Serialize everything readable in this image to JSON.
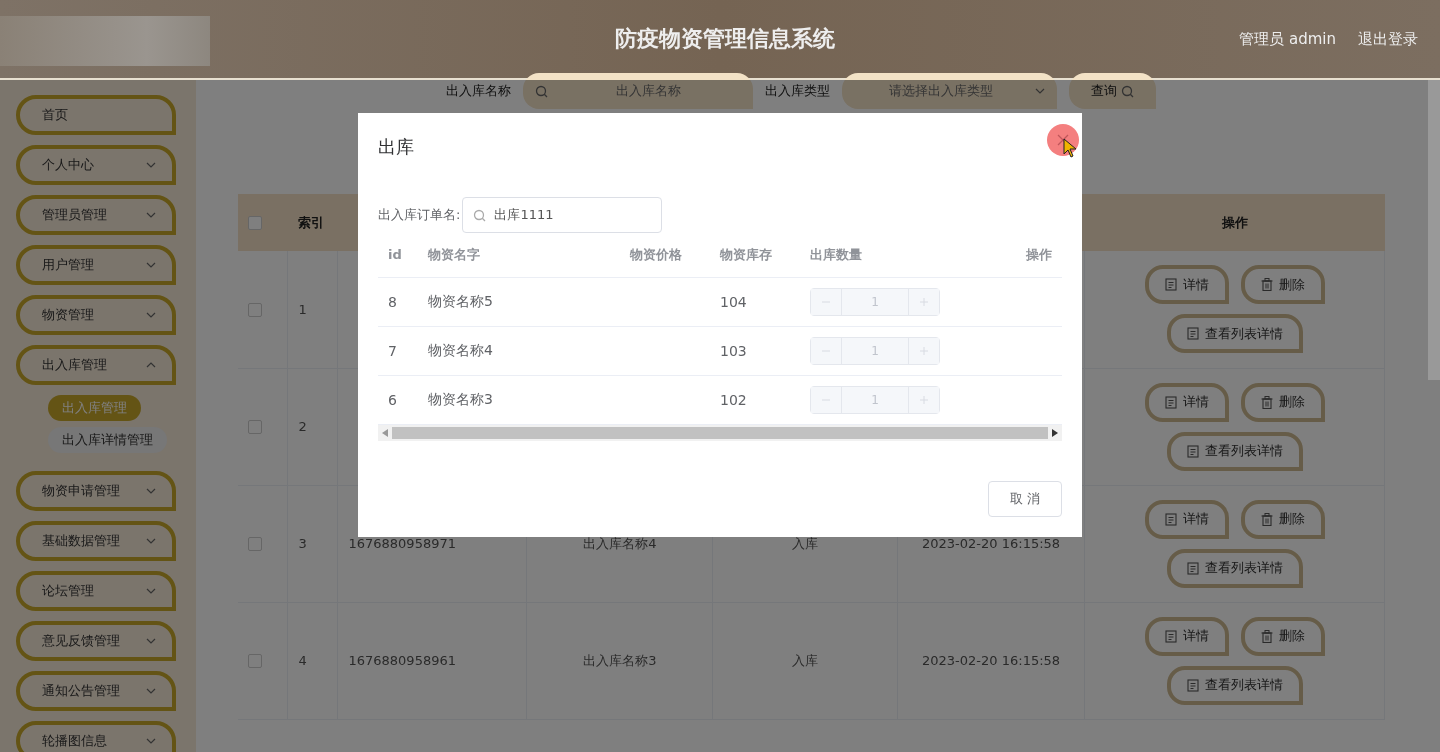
{
  "header": {
    "title": "防疫物资管理信息系统",
    "user": "管理员 admin",
    "logout": "退出登录"
  },
  "sidebar": {
    "items": [
      {
        "label": "首页",
        "kind": "link"
      },
      {
        "label": "个人中心",
        "kind": "menu",
        "expanded": false
      },
      {
        "label": "管理员管理",
        "kind": "menu",
        "expanded": false
      },
      {
        "label": "用户管理",
        "kind": "menu",
        "expanded": false
      },
      {
        "label": "物资管理",
        "kind": "menu",
        "expanded": false
      },
      {
        "label": "出入库管理",
        "kind": "menu",
        "expanded": true,
        "children": [
          {
            "label": "出入库管理",
            "selected": true
          },
          {
            "label": "出入库详情管理",
            "selected": false
          }
        ]
      },
      {
        "label": "物资申请管理",
        "kind": "menu",
        "expanded": false
      },
      {
        "label": "基础数据管理",
        "kind": "menu",
        "expanded": false
      },
      {
        "label": "论坛管理",
        "kind": "menu",
        "expanded": false
      },
      {
        "label": "意见反馈管理",
        "kind": "menu",
        "expanded": false
      },
      {
        "label": "通知公告管理",
        "kind": "menu",
        "expanded": false
      },
      {
        "label": "轮播图信息",
        "kind": "menu",
        "expanded": false
      }
    ]
  },
  "search": {
    "fields": [
      {
        "label": "出入库名称",
        "kind": "text",
        "placeholder": "出入库名称"
      },
      {
        "label": "出入库类型",
        "kind": "select",
        "placeholder": "请选择出入库类型"
      }
    ],
    "button": "查询"
  },
  "table": {
    "select_all": {
      "checked": false
    },
    "columns": {
      "index": "索引",
      "actions": "操作"
    },
    "rows": [
      {
        "checked": false,
        "index": "1",
        "actions": [
          {
            "label": "详情",
            "kind": "detail"
          },
          {
            "label": "删除",
            "kind": "delete"
          },
          {
            "label": "查看列表详情",
            "kind": "list"
          }
        ]
      },
      {
        "checked": false,
        "index": "2",
        "actions": [
          {
            "label": "详情",
            "kind": "detail"
          },
          {
            "label": "删除",
            "kind": "delete"
          },
          {
            "label": "查看列表详情",
            "kind": "list"
          }
        ]
      },
      {
        "checked": false,
        "index": "3",
        "column_3": "1676880958971",
        "column_4": "出入库名称4",
        "column_5": "入库",
        "column_6": "2023-02-20 16:15:58",
        "actions": [
          {
            "label": "详情",
            "kind": "detail"
          },
          {
            "label": "删除",
            "kind": "delete"
          },
          {
            "label": "查看列表详情",
            "kind": "list"
          }
        ]
      },
      {
        "checked": false,
        "index": "4",
        "column_3": "1676880958961",
        "column_4": "出入库名称3",
        "column_5": "入库",
        "column_6": "2023-02-20 16:15:58",
        "actions": [
          {
            "label": "详情",
            "kind": "detail"
          },
          {
            "label": "删除",
            "kind": "delete"
          },
          {
            "label": "查看列表详情",
            "kind": "list"
          }
        ]
      }
    ]
  },
  "dialog": {
    "title": "出库",
    "field": {
      "label": "出入库订单名:",
      "value": "出库1111"
    },
    "columns": [
      "id",
      "物资名字",
      "物资价格",
      "物资库存",
      "出库数量",
      "操作"
    ],
    "rows": [
      {
        "id": "8",
        "name": "物资名称5",
        "stock": "104",
        "quantity": "1",
        "disabled": true
      },
      {
        "id": "7",
        "name": "物资名称4",
        "stock": "103",
        "quantity": "1",
        "disabled": true
      },
      {
        "id": "6",
        "name": "物资名称3",
        "stock": "102",
        "quantity": "1",
        "disabled": true
      }
    ],
    "cancel": "取 消"
  }
}
